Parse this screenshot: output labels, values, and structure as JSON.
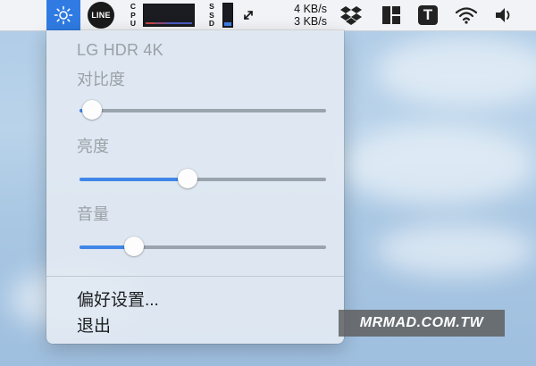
{
  "menubar": {
    "line_label": "LINE",
    "cpu_label": [
      "C",
      "P",
      "U"
    ],
    "ssd_label": [
      "S",
      "S",
      "D"
    ],
    "net_up": "4 KB/s",
    "net_down": "3 KB/s",
    "t_label": "T",
    "icons": [
      "brightness-sun-icon",
      "line-app-icon",
      "cpu-graph",
      "ssd-indicator",
      "expand-arrows-icon",
      "dropbox-icon",
      "layout-icon",
      "t-app-icon",
      "wifi-icon",
      "volume-icon"
    ],
    "ssd_level": 0.15,
    "cpu_level": 0.1
  },
  "menu": {
    "display_name": "LG HDR 4K",
    "contrast_label": "对比度",
    "contrast_value": 0.05,
    "brightness_label": "亮度",
    "brightness_value": 0.44,
    "volume_label": "音量",
    "volume_value": 0.22,
    "preferences_label": "偏好设置...",
    "quit_label": "退出"
  },
  "watermark": "MRMAD.COM.TW",
  "colors": {
    "accent": "#2f7be3",
    "slider_fill": "#3f86e8",
    "menu_bg": "#e2eaf2"
  }
}
